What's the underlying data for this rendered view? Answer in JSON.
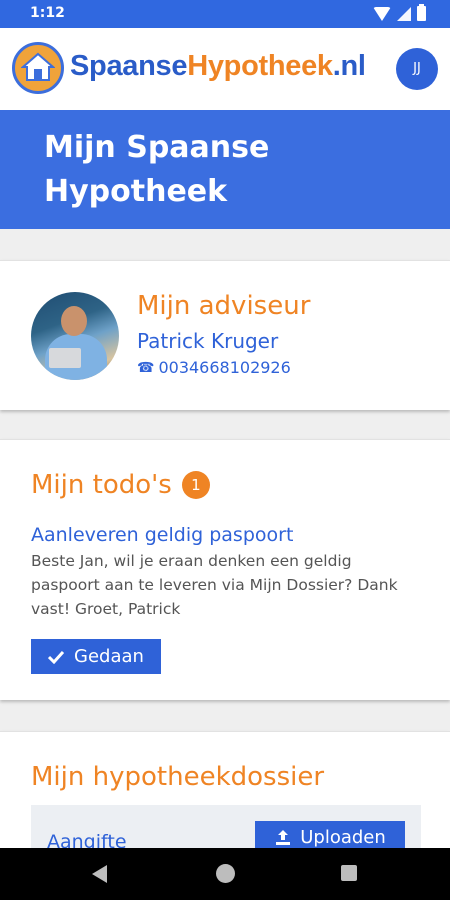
{
  "status_bar": {
    "time": "1:12"
  },
  "brand": {
    "part1": "Spaanse",
    "part2": "Hypotheek",
    "part3": ".nl"
  },
  "user": {
    "initials": "JJ"
  },
  "hero": {
    "title": "Mijn Spaanse Hypotheek"
  },
  "advisor": {
    "heading": "Mijn adviseur",
    "name": "Patrick Kruger",
    "phone": "0034668102926"
  },
  "todos": {
    "heading": "Mijn todo's",
    "count": "1",
    "item": {
      "title": "Aanleveren geldig paspoort",
      "text": "Beste Jan, wil je eraan denken een geldig paspoort aan te leveren via Mijn Dossier? Dank vast! Groet, Patrick",
      "done_label": "Gedaan"
    }
  },
  "dossier": {
    "heading": "Mijn hypotheekdossier",
    "row_label": "Aangifte",
    "upload_label": "Uploaden"
  },
  "icons": {
    "logo": "house-icon",
    "phone": "phone-icon",
    "check": "check-icon",
    "upload": "upload-icon"
  },
  "colors": {
    "primary": "#2f62d8",
    "accent": "#ef8424",
    "hero": "#3b6ee0"
  }
}
